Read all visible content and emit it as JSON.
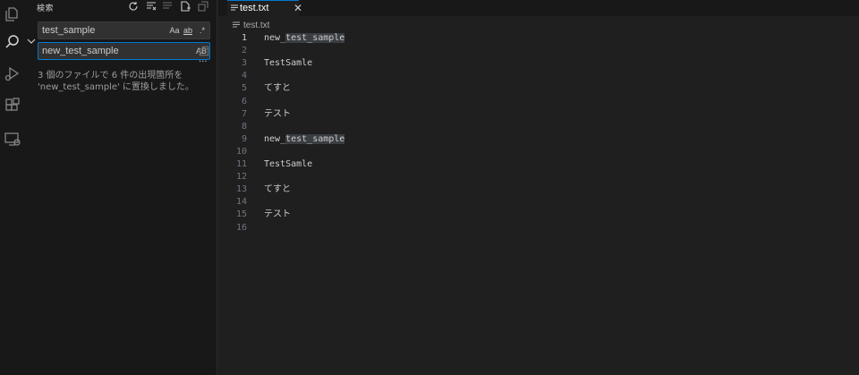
{
  "sidebar": {
    "title": "検索",
    "search": {
      "value": "test_sample",
      "options": [
        "Aa",
        "ab",
        ".*"
      ]
    },
    "replace": {
      "value": "new_test_sample",
      "options": [
        "AB"
      ]
    },
    "more": "···",
    "message_line1": "3 個のファイルで 6 件の出現箇所を",
    "message_line2": "'new_test_sample' に置換しました。"
  },
  "editor": {
    "tab": {
      "label": "test.txt",
      "close": "✕"
    },
    "breadcrumb": "test.txt",
    "lines": [
      {
        "num": "1",
        "pre": "new_",
        "match": "test_sample",
        "post": ""
      },
      {
        "num": "2",
        "pre": "",
        "match": "",
        "post": ""
      },
      {
        "num": "3",
        "pre": "TestSamle",
        "match": "",
        "post": ""
      },
      {
        "num": "4",
        "pre": "",
        "match": "",
        "post": ""
      },
      {
        "num": "5",
        "pre": "てすと",
        "match": "",
        "post": ""
      },
      {
        "num": "6",
        "pre": "",
        "match": "",
        "post": ""
      },
      {
        "num": "7",
        "pre": "テスト",
        "match": "",
        "post": ""
      },
      {
        "num": "8",
        "pre": "",
        "match": "",
        "post": ""
      },
      {
        "num": "9",
        "pre": "new_",
        "match": "test_sample",
        "post": ""
      },
      {
        "num": "10",
        "pre": "",
        "match": "",
        "post": ""
      },
      {
        "num": "11",
        "pre": "TestSamle",
        "match": "",
        "post": ""
      },
      {
        "num": "12",
        "pre": "",
        "match": "",
        "post": ""
      },
      {
        "num": "13",
        "pre": "てすと",
        "match": "",
        "post": ""
      },
      {
        "num": "14",
        "pre": "",
        "match": "",
        "post": ""
      },
      {
        "num": "15",
        "pre": "テスト",
        "match": "",
        "post": ""
      },
      {
        "num": "16",
        "pre": "",
        "match": "",
        "post": ""
      }
    ]
  },
  "icons": {
    "explorer": "explorer-icon",
    "search": "search-icon",
    "run": "run-debug-icon",
    "extensions": "extensions-icon",
    "remote": "remote-explorer-icon"
  }
}
